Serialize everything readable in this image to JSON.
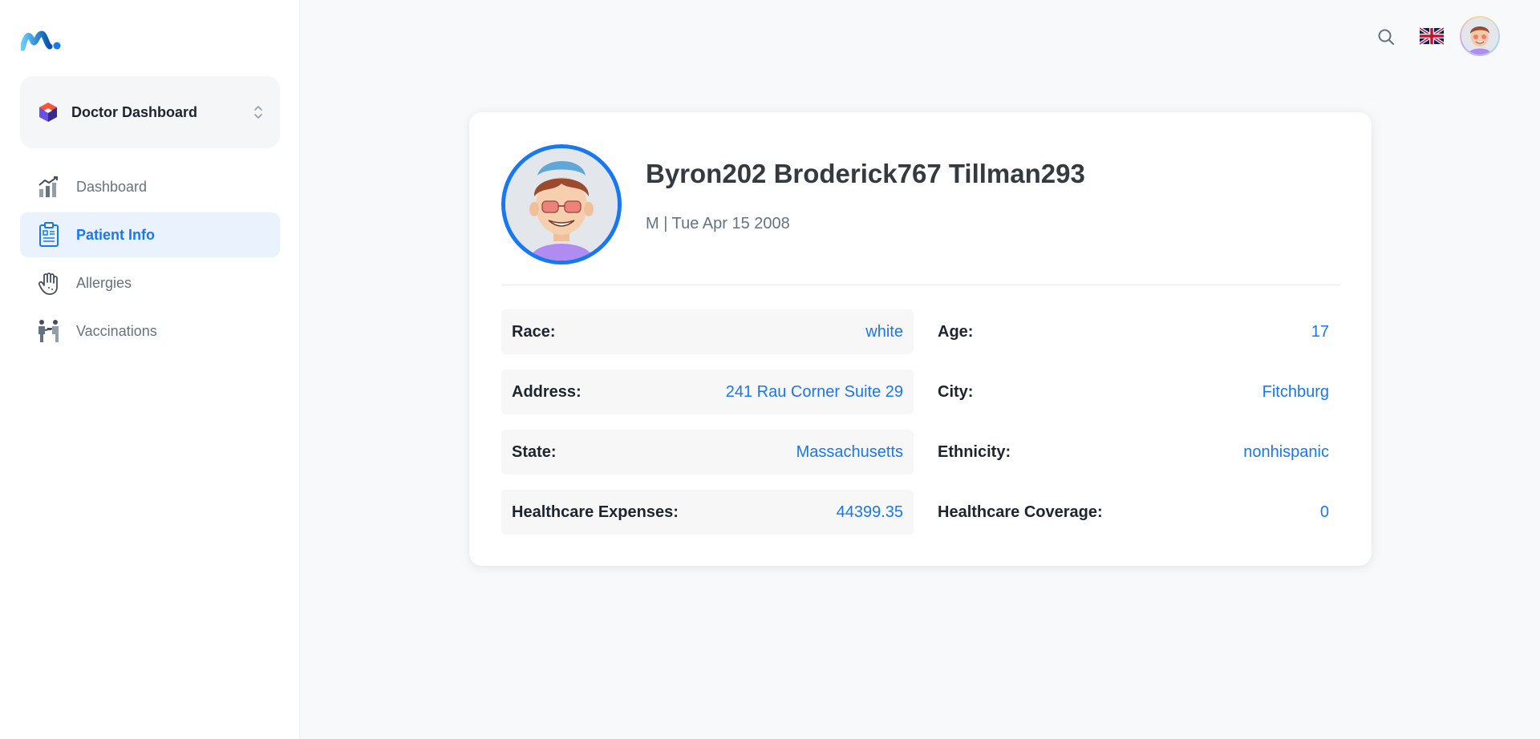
{
  "sidebar": {
    "workspace": {
      "label": "Doctor Dashboard"
    },
    "items": [
      {
        "label": "Dashboard",
        "icon": "chart-icon",
        "active": false
      },
      {
        "label": "Patient Info",
        "icon": "clipboard-icon",
        "active": true
      },
      {
        "label": "Allergies",
        "icon": "hand-icon",
        "active": false
      },
      {
        "label": "Vaccinations",
        "icon": "vaccination-icon",
        "active": false
      }
    ]
  },
  "header": {
    "search_icon": "search-icon",
    "language_icon": "uk-flag-icon",
    "account_icon": "avatar"
  },
  "patient": {
    "name": "Byron202 Broderick767 Tillman293",
    "meta": "M | Tue Apr 15 2008",
    "fields": {
      "race": {
        "label": "Race:",
        "value": "white"
      },
      "age": {
        "label": "Age:",
        "value": "17"
      },
      "address": {
        "label": "Address:",
        "value": "241 Rau Corner Suite 29"
      },
      "city": {
        "label": "City:",
        "value": "Fitchburg"
      },
      "state": {
        "label": "State:",
        "value": "Massachusetts"
      },
      "ethnicity": {
        "label": "Ethnicity:",
        "value": "nonhispanic"
      },
      "expenses": {
        "label": "Healthcare Expenses:",
        "value": "44399.35"
      },
      "coverage": {
        "label": "Healthcare Coverage:",
        "value": "0"
      }
    }
  },
  "colors": {
    "primary": "#1877f2",
    "active_bg": "#e9f2fd",
    "text": "#1c252e",
    "muted": "#637381"
  }
}
